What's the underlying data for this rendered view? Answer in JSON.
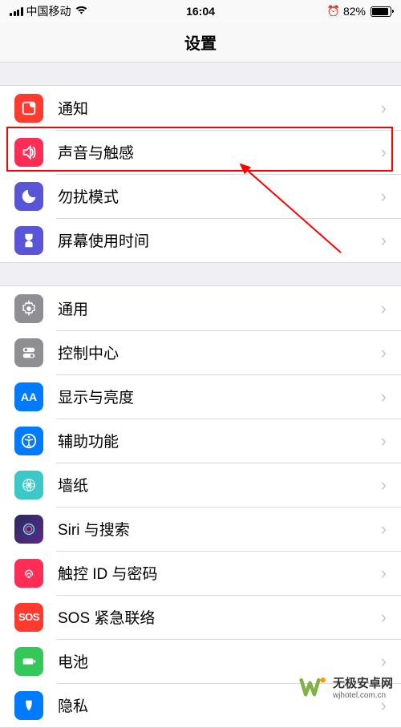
{
  "status_bar": {
    "carrier": "中国移动",
    "time": "16:04",
    "battery_percent": "82%"
  },
  "header": {
    "title": "设置"
  },
  "groups": [
    {
      "items": [
        {
          "id": "notifications",
          "label": "通知",
          "icon": "notify"
        },
        {
          "id": "sounds",
          "label": "声音与触感",
          "icon": "sound"
        },
        {
          "id": "dnd",
          "label": "勿扰模式",
          "icon": "dnd"
        },
        {
          "id": "screentime",
          "label": "屏幕使用时间",
          "icon": "screen"
        }
      ]
    },
    {
      "items": [
        {
          "id": "general",
          "label": "通用",
          "icon": "general"
        },
        {
          "id": "controlcenter",
          "label": "控制中心",
          "icon": "control"
        },
        {
          "id": "display",
          "label": "显示与亮度",
          "icon": "display"
        },
        {
          "id": "accessibility",
          "label": "辅助功能",
          "icon": "access"
        },
        {
          "id": "wallpaper",
          "label": "墙纸",
          "icon": "wallpaper"
        },
        {
          "id": "siri",
          "label": "Siri 与搜索",
          "icon": "siri"
        },
        {
          "id": "touchid",
          "label": "触控 ID 与密码",
          "icon": "touchid"
        },
        {
          "id": "sos",
          "label": "SOS 紧急联络",
          "icon": "sos"
        },
        {
          "id": "battery",
          "label": "电池",
          "icon": "battery"
        },
        {
          "id": "privacy",
          "label": "隐私",
          "icon": "privacy"
        }
      ]
    }
  ],
  "watermark": {
    "name_cn": "无极安卓网",
    "name_en": "wjhotel.com.cn"
  },
  "highlight_index": {
    "group": 0,
    "item": 1
  }
}
